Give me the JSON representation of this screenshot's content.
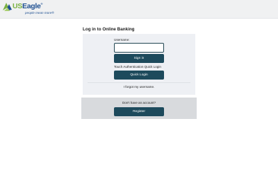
{
  "header": {
    "logo": {
      "brand_us": "US",
      "brand_eagle": "Eagle",
      "reg_mark": "®",
      "tagline": "people mean more",
      "reg_mark_small": "®",
      "colors": {
        "green": "#7ab142",
        "blue": "#1d4f91"
      }
    }
  },
  "login": {
    "title": "Log in to Online Banking",
    "username_label": "Username:",
    "username_value": "",
    "sign_in_label": "Sign in",
    "touch_auth_label": "Touch Authentication Quick Login",
    "quick_login_label": "Quick Login",
    "forgot_username_label": "I forgot my username."
  },
  "register": {
    "prompt": "Don't have an account?",
    "button_label": "Register"
  },
  "colors": {
    "button_bg": "#1d4a5c",
    "panel_bg": "#eef0f4",
    "register_bg": "#d8dadd",
    "header_bg": "#f0f1f2"
  }
}
